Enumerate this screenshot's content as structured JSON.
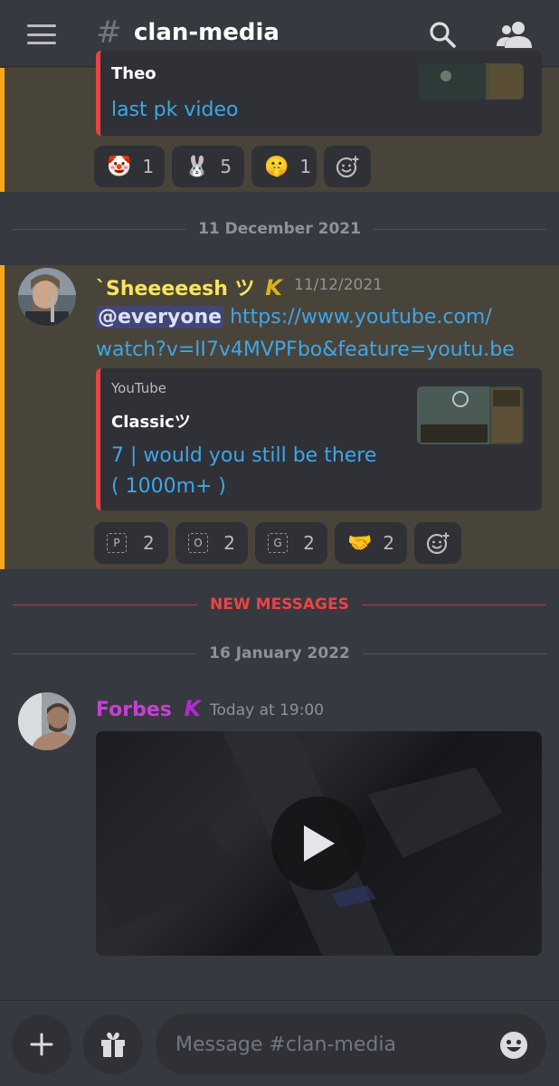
{
  "header": {
    "channel_name": "clan-media",
    "hash_symbol": "#"
  },
  "message1": {
    "embed": {
      "author": "Theo",
      "title": "last pk video"
    },
    "reactions": [
      {
        "emoji": "🤡",
        "count": "1"
      },
      {
        "emoji": "🐰",
        "count": "5"
      },
      {
        "emoji": "🤫",
        "count": "1"
      }
    ]
  },
  "divider_1": "11 December 2021",
  "message2": {
    "username": "`Sheeeeesh ツ",
    "badge": "K",
    "timestamp": "11/12/2021",
    "mention": "@everyone",
    "link_line1": "https://www.youtube.com/",
    "link_line2": "watch?v=lI7v4MVPFbo&feature=youtu.be",
    "embed": {
      "provider": "YouTube",
      "author": "Classicツ",
      "title_line1": "7 | would you still be there",
      "title_line2": "( 1000m+ )"
    },
    "reactions": [
      {
        "emoji": "P",
        "count": "2"
      },
      {
        "emoji": "O",
        "count": "2"
      },
      {
        "emoji": "G",
        "count": "2"
      },
      {
        "emoji": "🤝",
        "count": "2"
      }
    ]
  },
  "new_messages_label": "NEW MESSAGES",
  "divider_2": "16 January 2022",
  "message3": {
    "username": "Forbes",
    "badge": "K",
    "timestamp": "Today at 19:00"
  },
  "composer": {
    "placeholder": "Message #clan-media"
  },
  "colors": {
    "accent_mention": "#faa81a",
    "link": "#3ea6e8",
    "new_messages": "#ed4245",
    "username_sheesh": "#f8e45c",
    "username_forbes": "#c73ed6"
  }
}
